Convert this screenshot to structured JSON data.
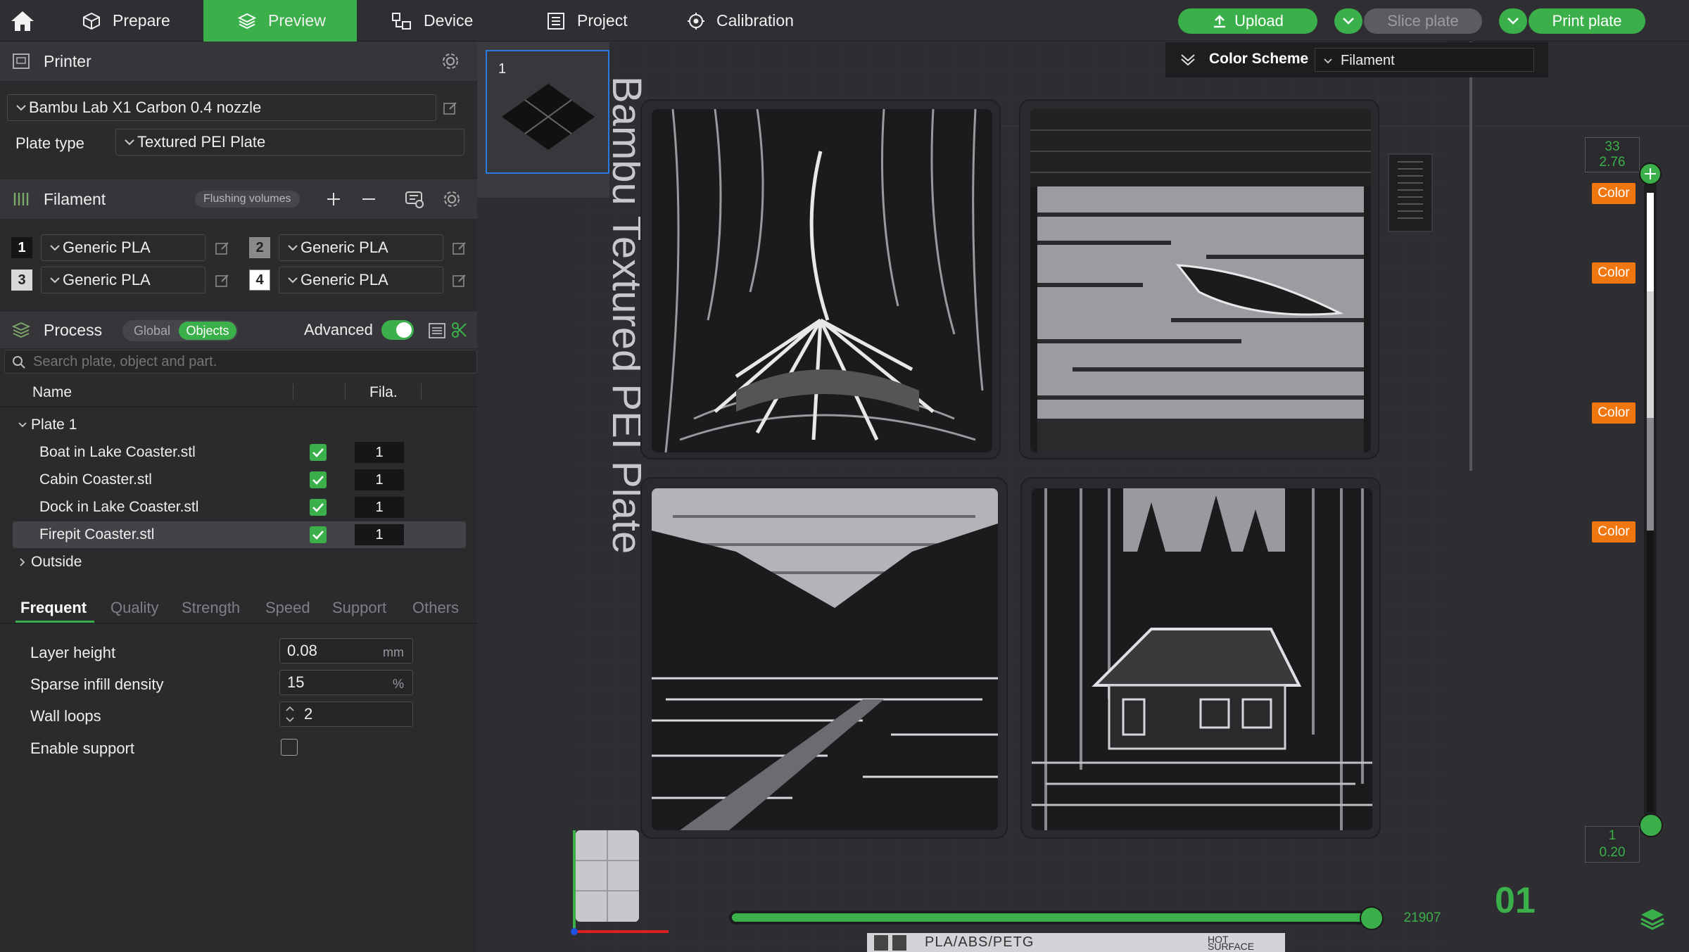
{
  "topbar": {
    "tabs": [
      {
        "label": "Prepare",
        "icon": "cube-icon"
      },
      {
        "label": "Preview",
        "icon": "layers-icon"
      },
      {
        "label": "Device",
        "icon": "device-icon"
      },
      {
        "label": "Project",
        "icon": "project-icon"
      },
      {
        "label": "Calibration",
        "icon": "calibration-icon"
      }
    ],
    "active_tab": "Preview",
    "upload_label": "Upload",
    "slice_label": "Slice plate",
    "print_label": "Print plate"
  },
  "printer": {
    "title": "Printer",
    "model": "Bambu Lab X1 Carbon 0.4 nozzle",
    "plate_type_label": "Plate type",
    "plate_type": "Textured PEI Plate"
  },
  "filament": {
    "title": "Filament",
    "flushing_label": "Flushing volumes",
    "slots": [
      {
        "num": "1",
        "name": "Generic PLA",
        "color": "#161616",
        "text": "#ffffff"
      },
      {
        "num": "2",
        "name": "Generic PLA",
        "color": "#8a8a8a",
        "text": "#222222"
      },
      {
        "num": "3",
        "name": "Generic PLA",
        "color": "#d8d8d8",
        "text": "#222222"
      },
      {
        "num": "4",
        "name": "Generic PLA",
        "color": "#ffffff",
        "text": "#222222"
      }
    ]
  },
  "process": {
    "title": "Process",
    "global_label": "Global",
    "objects_label": "Objects",
    "advanced_label": "Advanced",
    "advanced_on": true,
    "search_placeholder": "Search plate, object and part.",
    "col_name": "Name",
    "col_fila": "Fila.",
    "plate_label": "Plate 1",
    "objects": [
      {
        "name": "Boat in Lake Coaster.stl",
        "fila": "1"
      },
      {
        "name": "Cabin Coaster.stl",
        "fila": "1"
      },
      {
        "name": "Dock in Lake Coaster.stl",
        "fila": "1"
      },
      {
        "name": "Firepit Coaster.stl",
        "fila": "1"
      }
    ],
    "outside_label": "Outside",
    "tabs": [
      "Frequent",
      "Quality",
      "Strength",
      "Speed",
      "Support",
      "Others"
    ],
    "active_tab": "Frequent",
    "params": [
      {
        "label": "Layer height",
        "value": "0.08",
        "unit": "mm"
      },
      {
        "label": "Sparse infill density",
        "value": "15",
        "unit": "%"
      },
      {
        "label": "Wall loops",
        "value": "2",
        "unit": ""
      },
      {
        "label": "Enable support",
        "value": "",
        "unit": ""
      }
    ]
  },
  "preview": {
    "plate_thumb_num": "1",
    "plate_text": "Bambu Textured PEI Plate",
    "color_scheme_label": "Color Scheme",
    "color_scheme_value": "Filament",
    "slider_top_layer": "33",
    "slider_top_height": "2.76",
    "slider_bottom_layer": "1",
    "slider_bottom_height": "0.20",
    "color_labels": [
      "Color",
      "Color",
      "Color",
      "Color"
    ],
    "move_value": "21907",
    "plate_index": "01",
    "bottom_label": "PLA/ABS/PETG",
    "hot_label": "HOT SURFACE"
  },
  "colors": {
    "accent": "#3bb04a",
    "orange": "#f0760f"
  }
}
